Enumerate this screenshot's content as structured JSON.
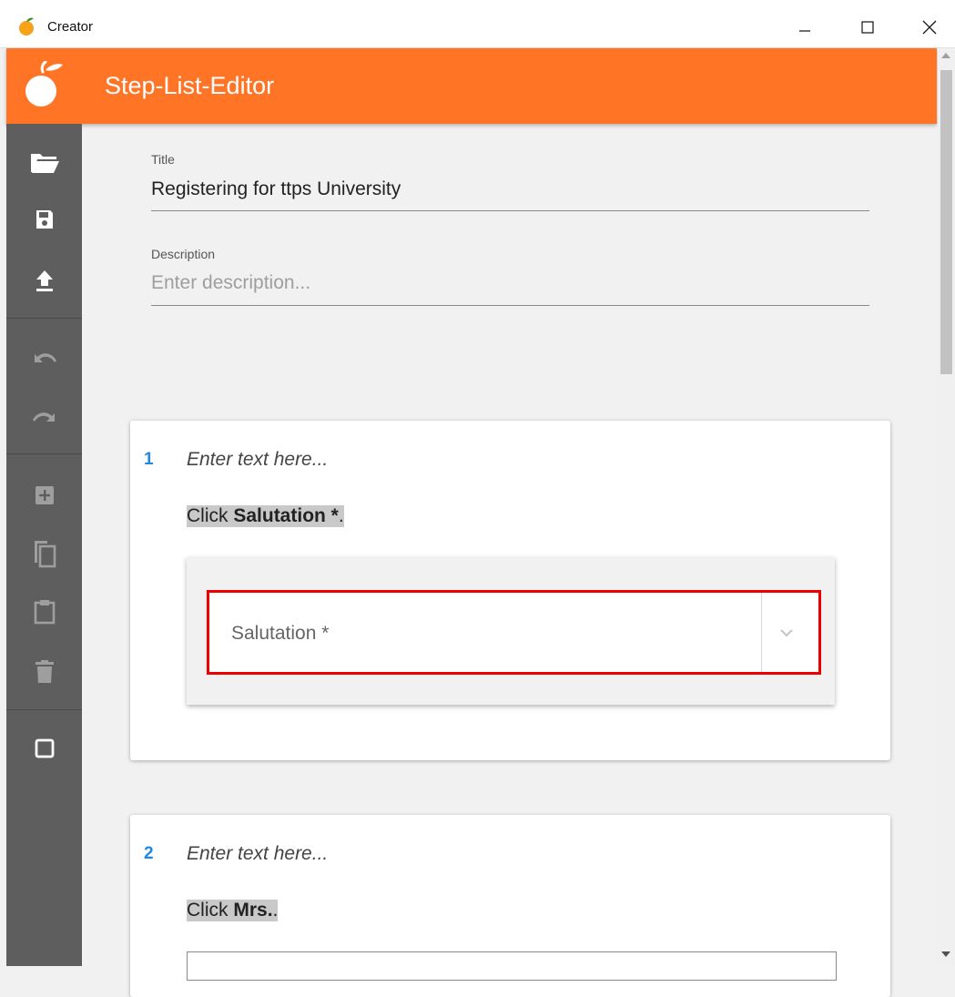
{
  "window": {
    "title": "Creator",
    "controls": {
      "minimize": "minimize-icon",
      "maximize": "maximize-icon",
      "close": "close-icon"
    }
  },
  "app": {
    "title": "Step-List-Editor",
    "accent_color": "#ff7425",
    "sidebar_color": "#5e5e5e"
  },
  "sidebar": {
    "items": [
      {
        "name": "open-folder-icon"
      },
      {
        "name": "save-icon"
      },
      {
        "name": "upload-icon"
      },
      {
        "name": "undo-icon"
      },
      {
        "name": "redo-icon"
      },
      {
        "name": "add-step-icon"
      },
      {
        "name": "copy-icon"
      },
      {
        "name": "paste-icon"
      },
      {
        "name": "delete-icon"
      },
      {
        "name": "frame-icon"
      }
    ]
  },
  "form": {
    "title_label": "Title",
    "title_value": "Registering for ttps University",
    "description_label": "Description",
    "description_placeholder": "Enter description...",
    "description_value": ""
  },
  "steps": [
    {
      "number": "1",
      "text_placeholder": "Enter text here...",
      "instruction_prefix": "Click ",
      "instruction_target": "Salutation *",
      "instruction_suffix": ".",
      "preview_field": "Salutation *",
      "highlight_color": "#ee0000"
    },
    {
      "number": "2",
      "text_placeholder": "Enter text here...",
      "instruction_prefix": "Click ",
      "instruction_target": "Mrs.",
      "instruction_suffix": "."
    }
  ]
}
